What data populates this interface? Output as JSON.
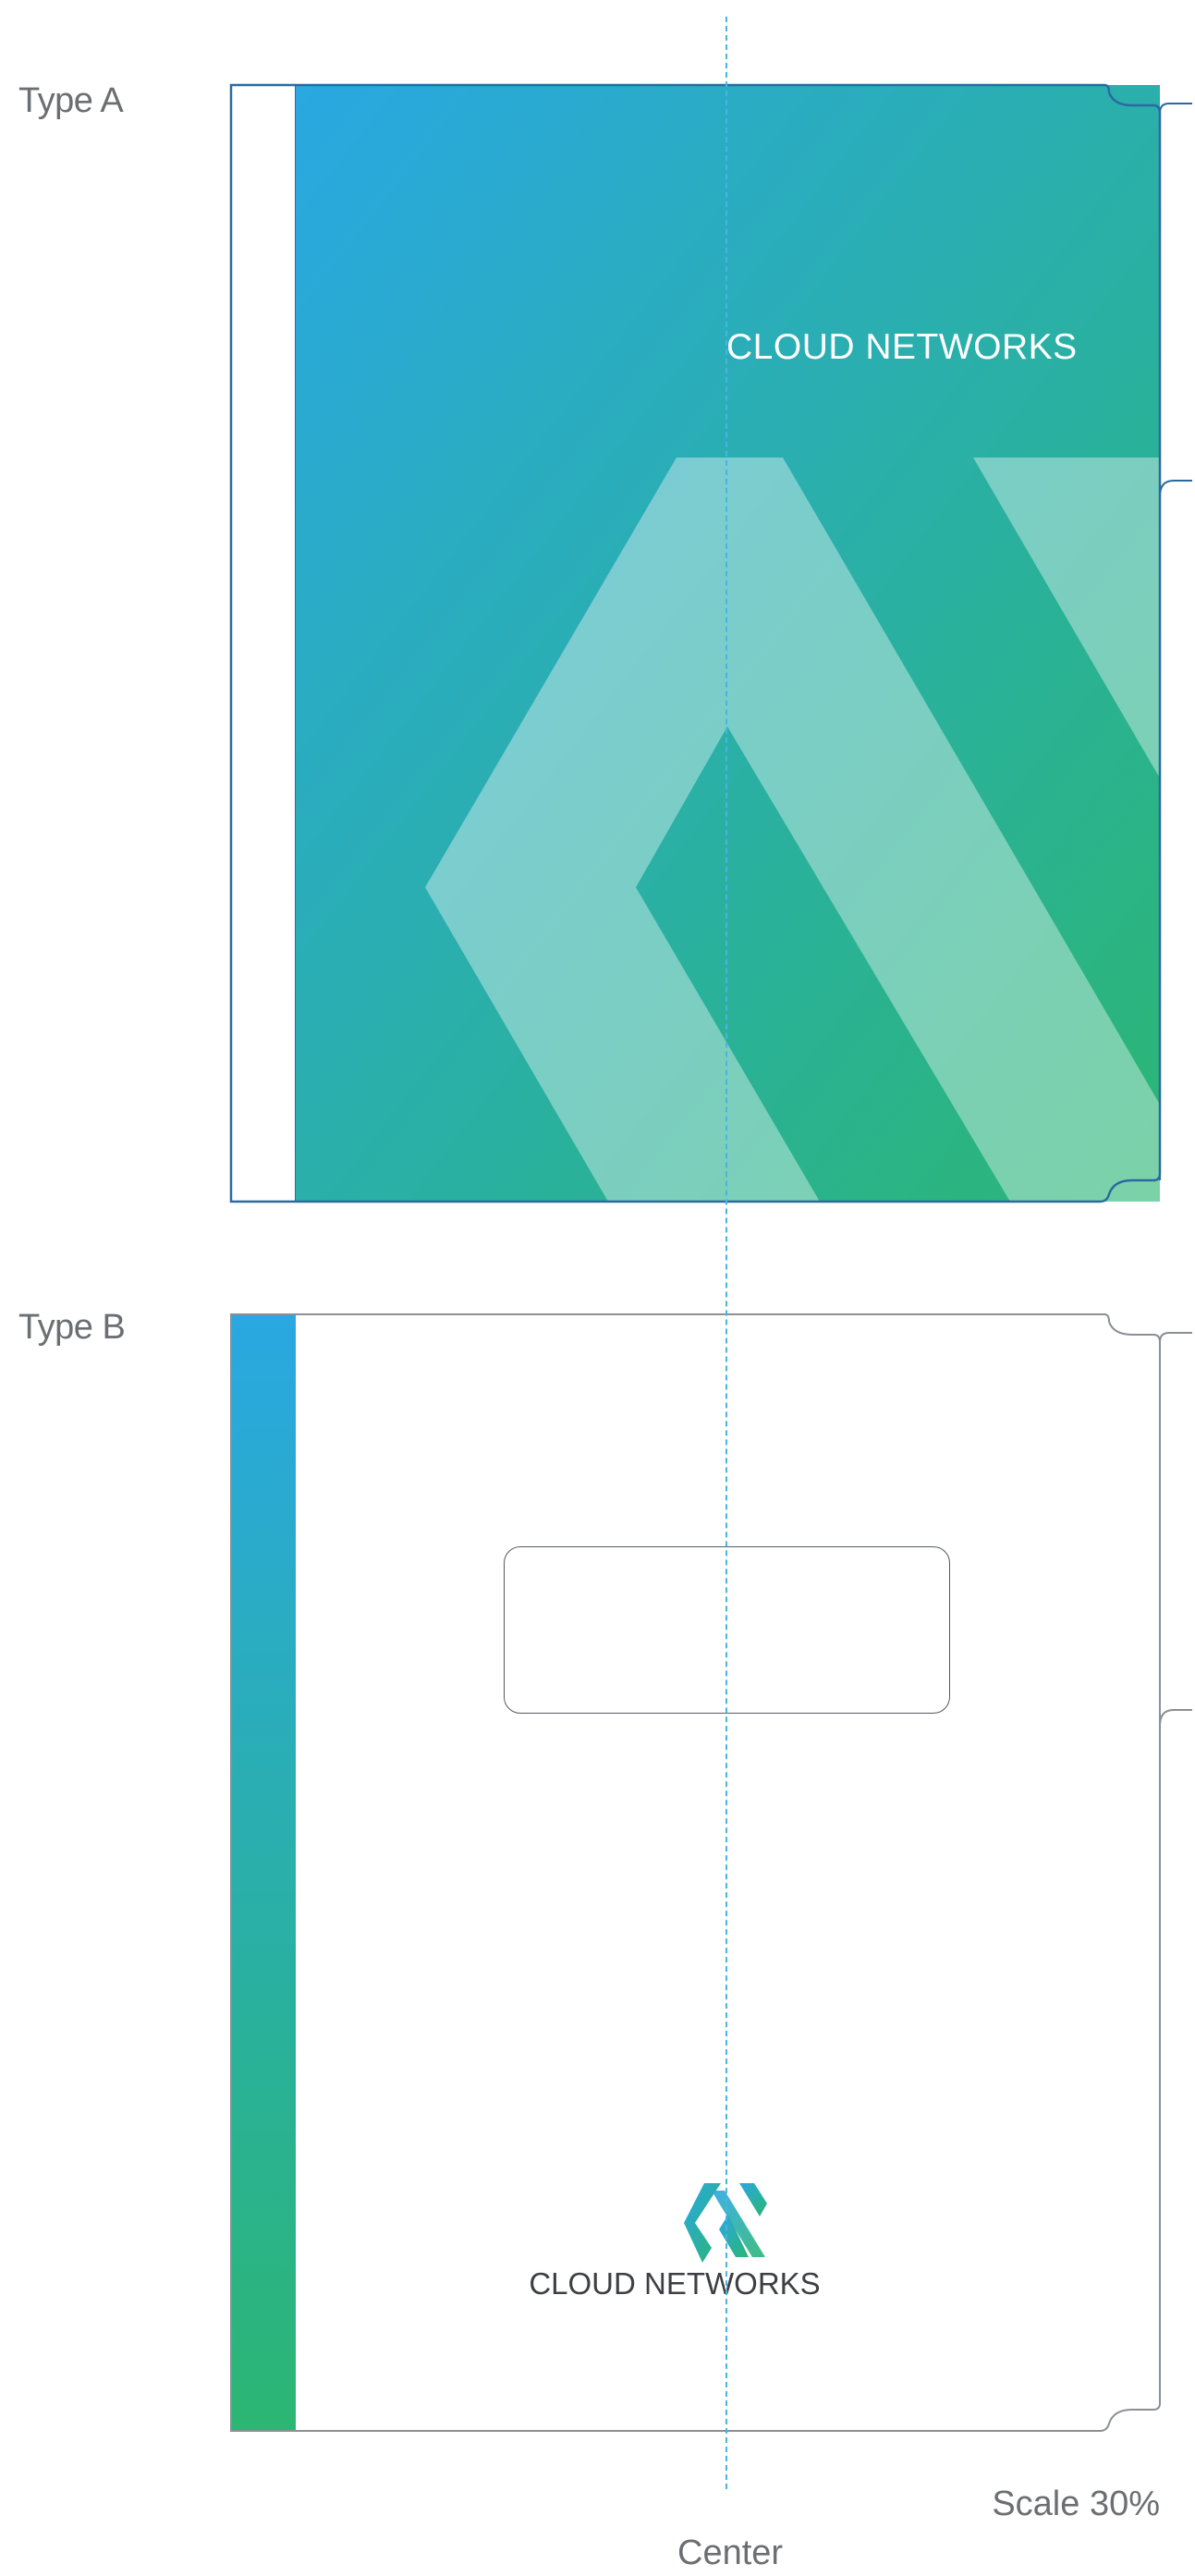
{
  "labels": {
    "type_a": "Type A",
    "type_b": "Type B",
    "scale": "Scale 30%",
    "center": "Center"
  },
  "folder_a": {
    "brand": "CLOUD NETWORKS",
    "gradient": {
      "start": "#29a8e2",
      "end": "#2bb673"
    },
    "stripe_color": "#ffffff"
  },
  "folder_b": {
    "brand": "CLOUD NETWORKS",
    "gradient": {
      "start": "#29a8e2",
      "end": "#2bb673"
    },
    "logo_icon": "cloud-networks-logo-icon"
  },
  "colors": {
    "outline": "#2b6aa0",
    "outline_b": "#8a9096",
    "center_line": "#4ab3e3",
    "label_text": "#6b6f74"
  }
}
